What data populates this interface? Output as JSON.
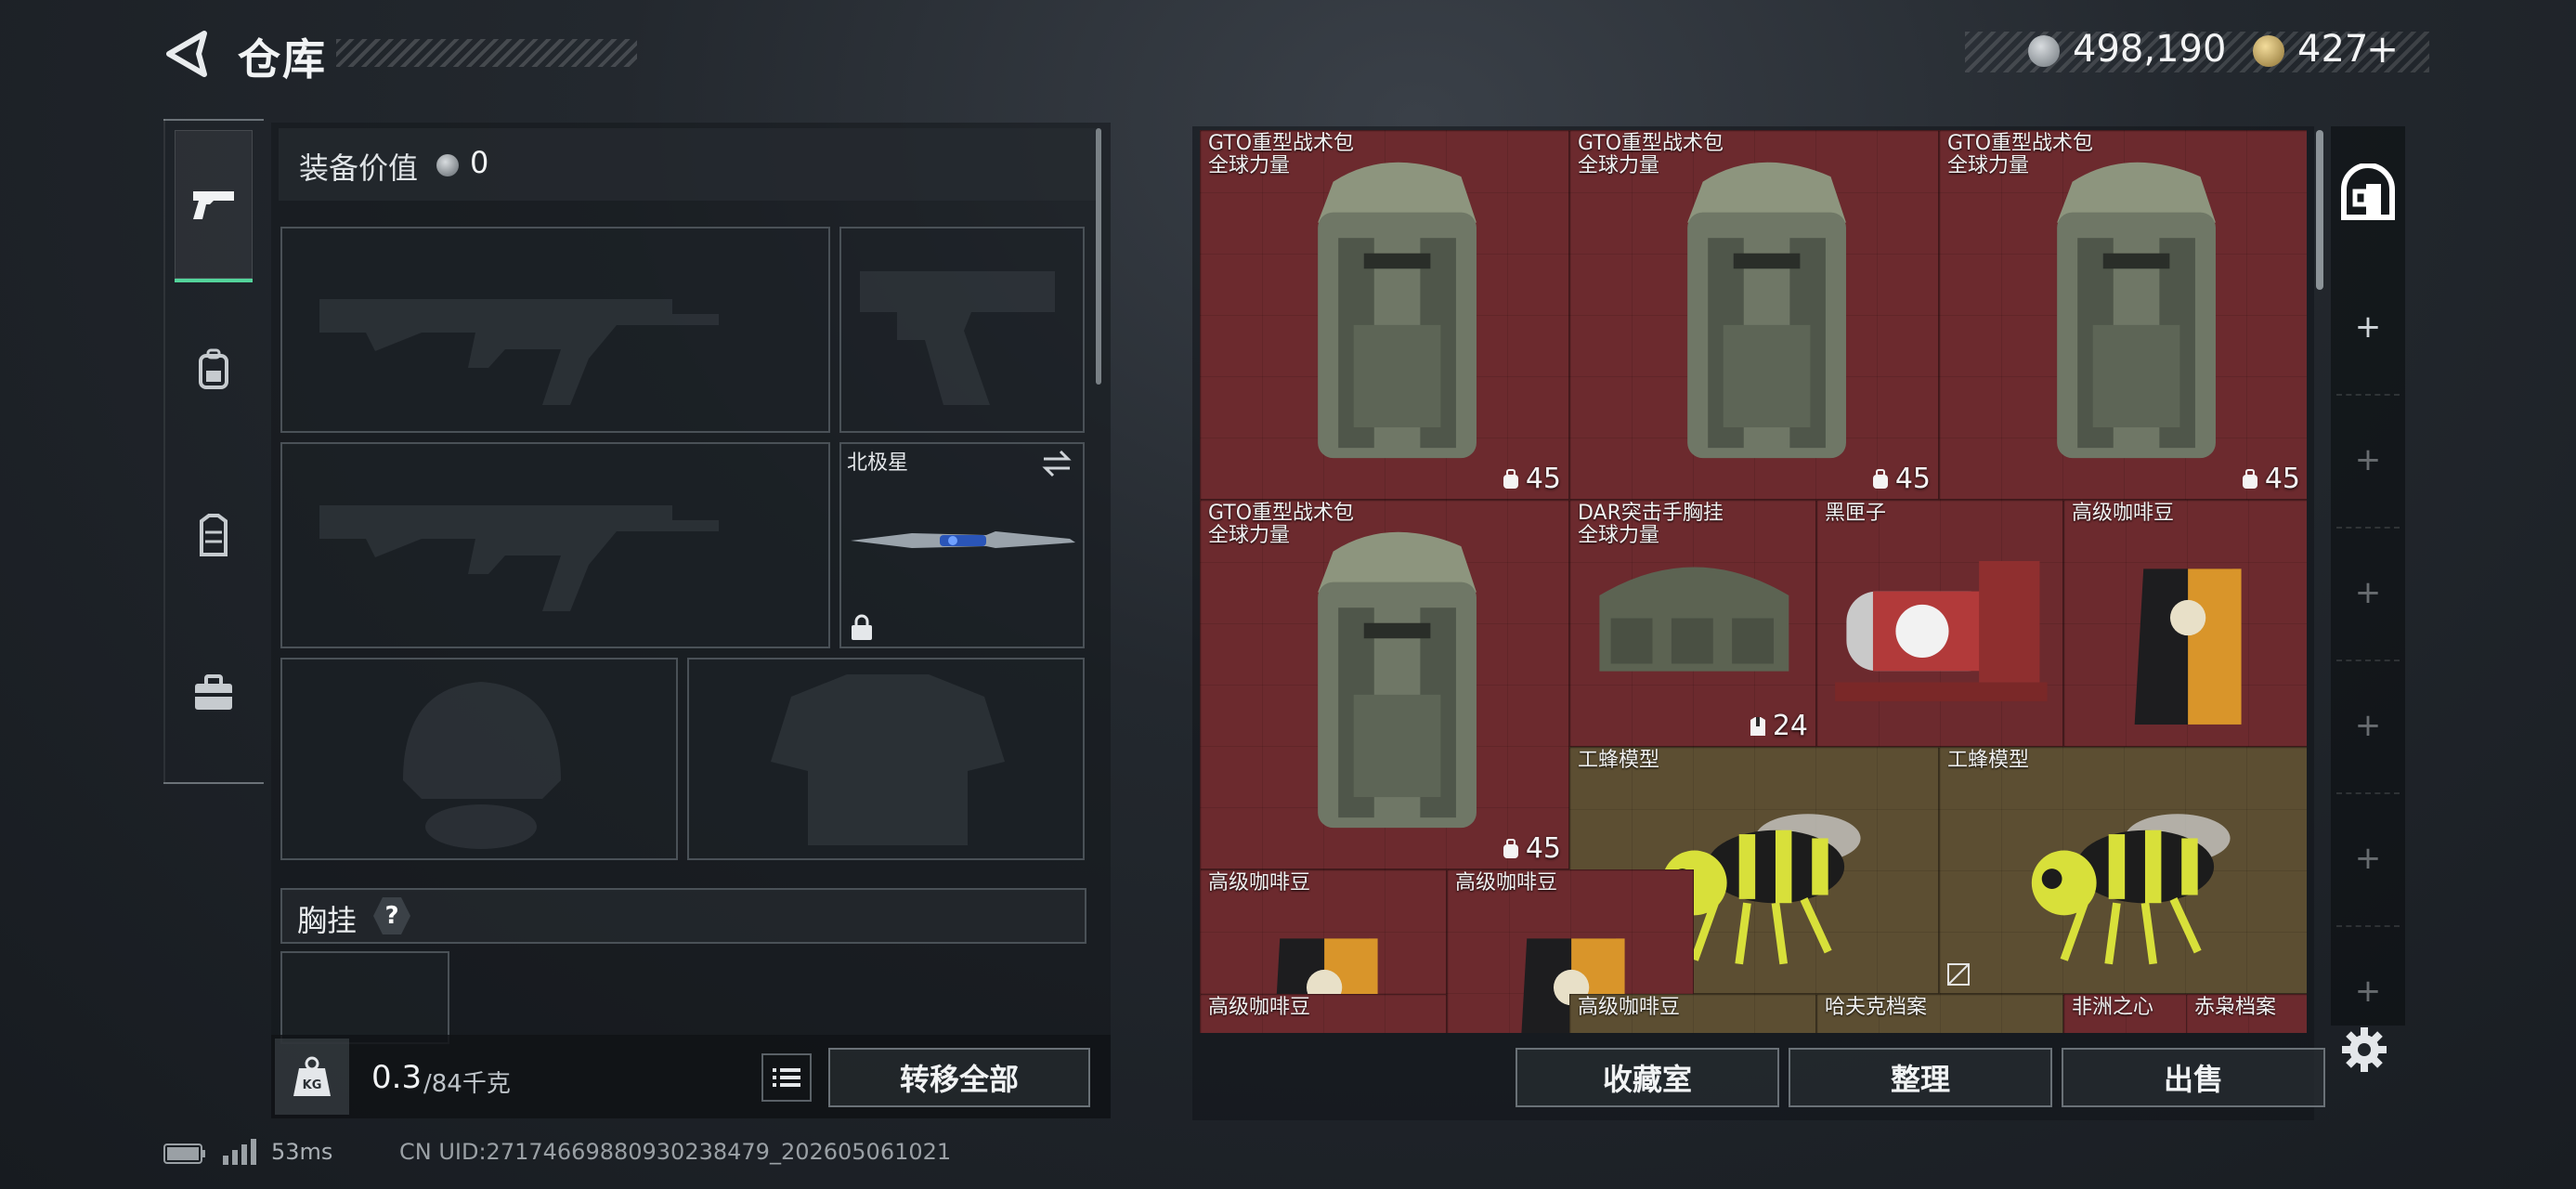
{
  "header": {
    "title": "仓库",
    "currency_silver": "498,190",
    "currency_gold": "427",
    "gold_plus": "+"
  },
  "nav": {
    "tabs": [
      {
        "icon": "pistol-icon",
        "active": true
      },
      {
        "icon": "backpack-icon",
        "active": false
      },
      {
        "icon": "vest-icon",
        "active": false
      },
      {
        "icon": "case-icon",
        "active": false
      }
    ]
  },
  "equipment": {
    "value_label": "装备价值",
    "value_amount": "0",
    "melee_name": "北极星",
    "chest_rig_label": "胸挂",
    "help_glyph": "?",
    "weight_current": "0.3",
    "weight_max": "/84千克",
    "weight_icon_text": "KG",
    "transfer_all": "转移全部"
  },
  "storage": {
    "items": [
      {
        "name": "GTO重型战术包",
        "sub": "全球力量",
        "count": "45",
        "count_icon": "backpack-count-icon",
        "rarity": "red",
        "art": "backpack"
      },
      {
        "name": "GTO重型战术包",
        "sub": "全球力量",
        "count": "45",
        "count_icon": "backpack-count-icon",
        "rarity": "red",
        "art": "backpack"
      },
      {
        "name": "GTO重型战术包",
        "sub": "全球力量",
        "count": "45",
        "count_icon": "backpack-count-icon",
        "rarity": "red",
        "art": "backpack"
      },
      {
        "name": "GTO重型战术包",
        "sub": "全球力量",
        "count": "45",
        "count_icon": "backpack-count-icon",
        "rarity": "red",
        "art": "backpack"
      },
      {
        "name": "DAR突击手胸挂",
        "sub": "全球力量",
        "count": "24",
        "count_icon": "vest-count-icon",
        "rarity": "red",
        "art": "duffel"
      },
      {
        "name": "黑匣子",
        "sub": "",
        "count": "",
        "rarity": "red",
        "art": "blackbox"
      },
      {
        "name": "高级咖啡豆",
        "sub": "",
        "count": "",
        "rarity": "red",
        "art": "coffee"
      },
      {
        "name": "工蜂模型",
        "sub": "",
        "count": "",
        "rarity": "gold",
        "art": "bee"
      },
      {
        "name": "工蜂模型",
        "sub": "",
        "count": "",
        "rarity": "gold",
        "art": "bee"
      },
      {
        "name": "高级咖啡豆",
        "sub": "",
        "count": "",
        "rarity": "red",
        "art": "coffee"
      },
      {
        "name": "高级咖啡豆",
        "sub": "",
        "count": "",
        "rarity": "red",
        "art": "coffee"
      },
      {
        "name": "高级咖啡豆",
        "sub": "",
        "count": "",
        "rarity": "red",
        "art": "coffee"
      },
      {
        "name": "高级咖啡豆",
        "sub": "",
        "count": "",
        "rarity": "gold",
        "art": "coffee"
      },
      {
        "name": "哈夫克档案",
        "sub": "",
        "count": "",
        "rarity": "gold",
        "art": "none"
      },
      {
        "name": "非洲之心",
        "sub": "",
        "count": "",
        "rarity": "red",
        "art": "none"
      },
      {
        "name": "赤枭档案",
        "sub": "",
        "count": "",
        "rarity": "red",
        "art": "none"
      }
    ]
  },
  "rail": {
    "add_glyph": "+"
  },
  "actions": {
    "collection": "收藏室",
    "sort": "整理",
    "sell": "出售"
  },
  "status": {
    "ping": "53ms",
    "uid": "CN UID:2717466988093023847​9_202605061021"
  },
  "colors": {
    "accent_green": "#53d49b",
    "rarity_red": "#6c2a2e",
    "rarity_gold": "#5c4e32"
  }
}
